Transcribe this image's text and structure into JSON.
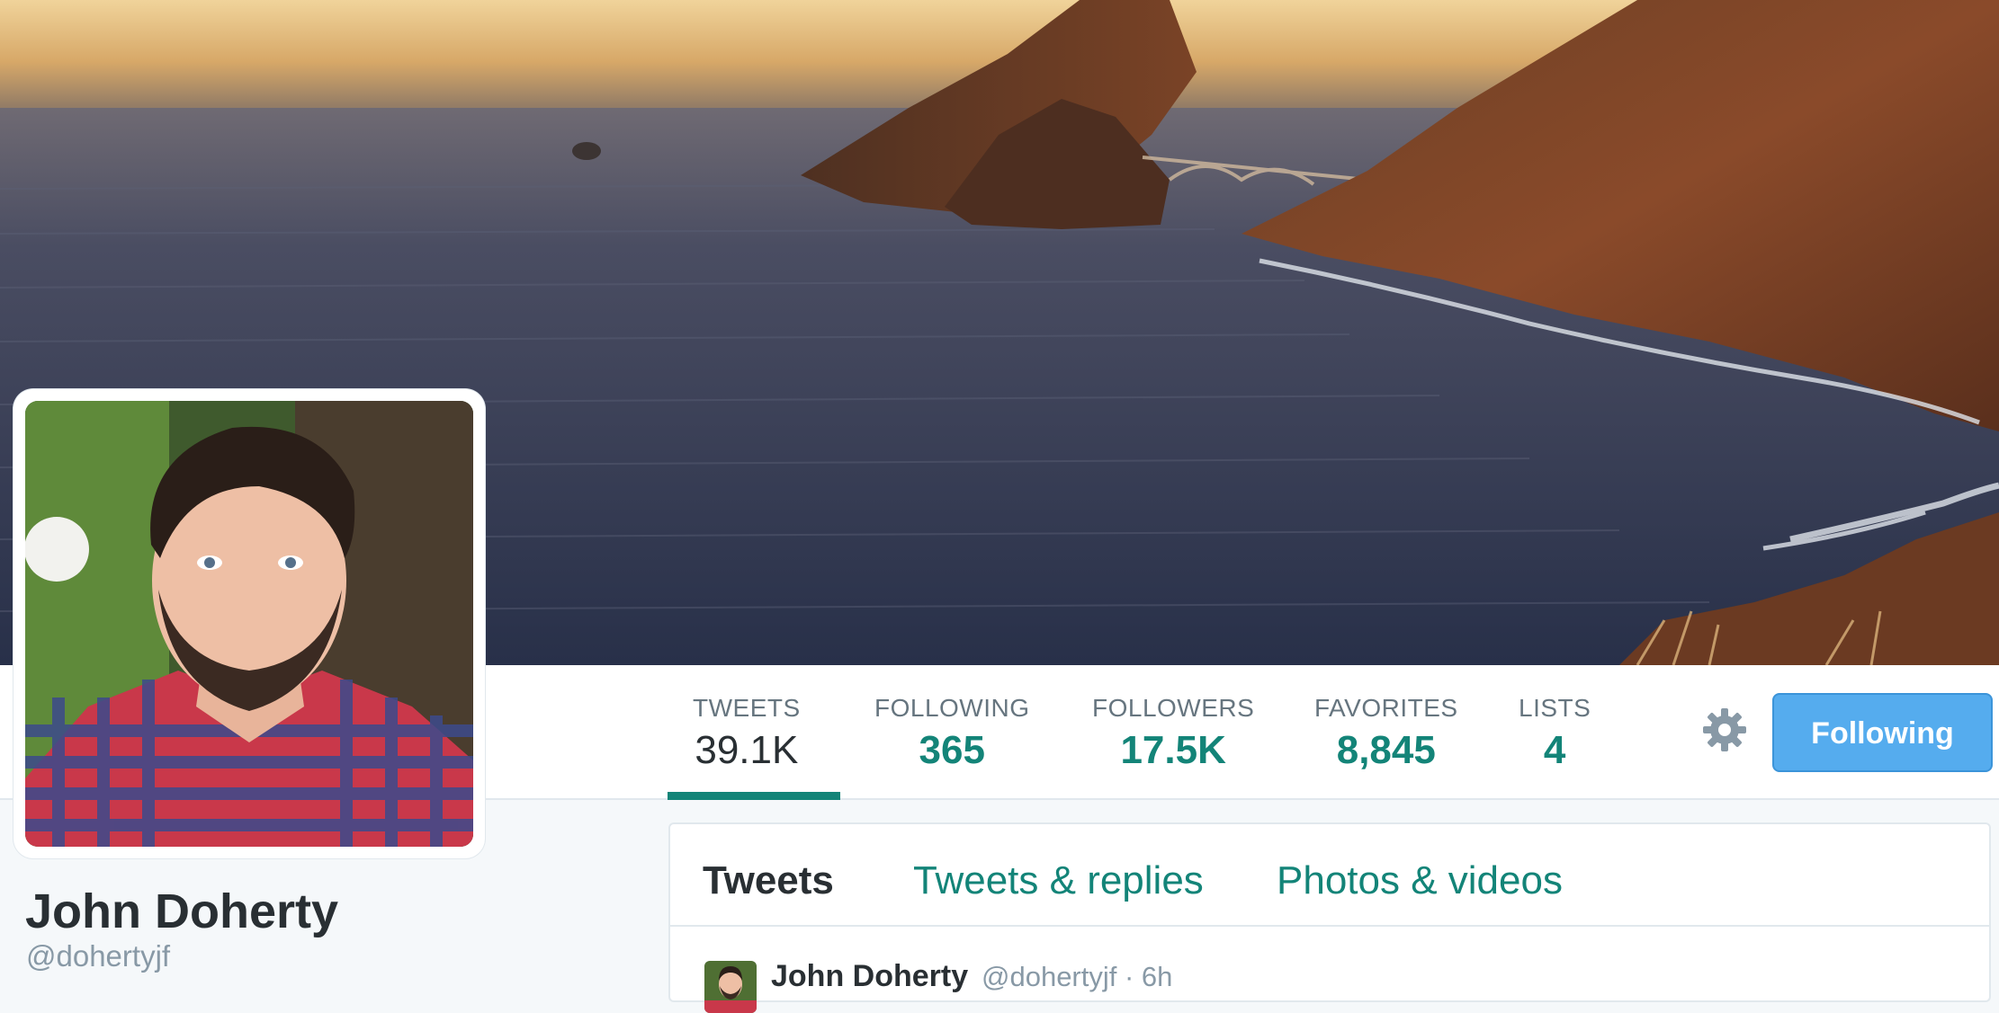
{
  "profile": {
    "name": "John Doherty",
    "handle": "@dohertyjf"
  },
  "stats": [
    {
      "label": "TWEETS",
      "value": "39.1K",
      "active": true
    },
    {
      "label": "FOLLOWING",
      "value": "365"
    },
    {
      "label": "FOLLOWERS",
      "value": "17.5K"
    },
    {
      "label": "FAVORITES",
      "value": "8,845"
    },
    {
      "label": "LISTS",
      "value": "4"
    }
  ],
  "actions": {
    "settings_icon": "gear-icon",
    "follow_label": "Following"
  },
  "timeline": {
    "tabs": [
      "Tweets",
      "Tweets & replies",
      "Photos & videos"
    ],
    "active_tab": "Tweets",
    "first_tweet": {
      "author_name": "John Doherty",
      "author_handle": "@dohertyjf",
      "time": "· 6h"
    }
  },
  "colors": {
    "accent": "#138478",
    "follow_button": "#55acee",
    "text_dark": "#292f33",
    "text_muted": "#8899a6"
  }
}
